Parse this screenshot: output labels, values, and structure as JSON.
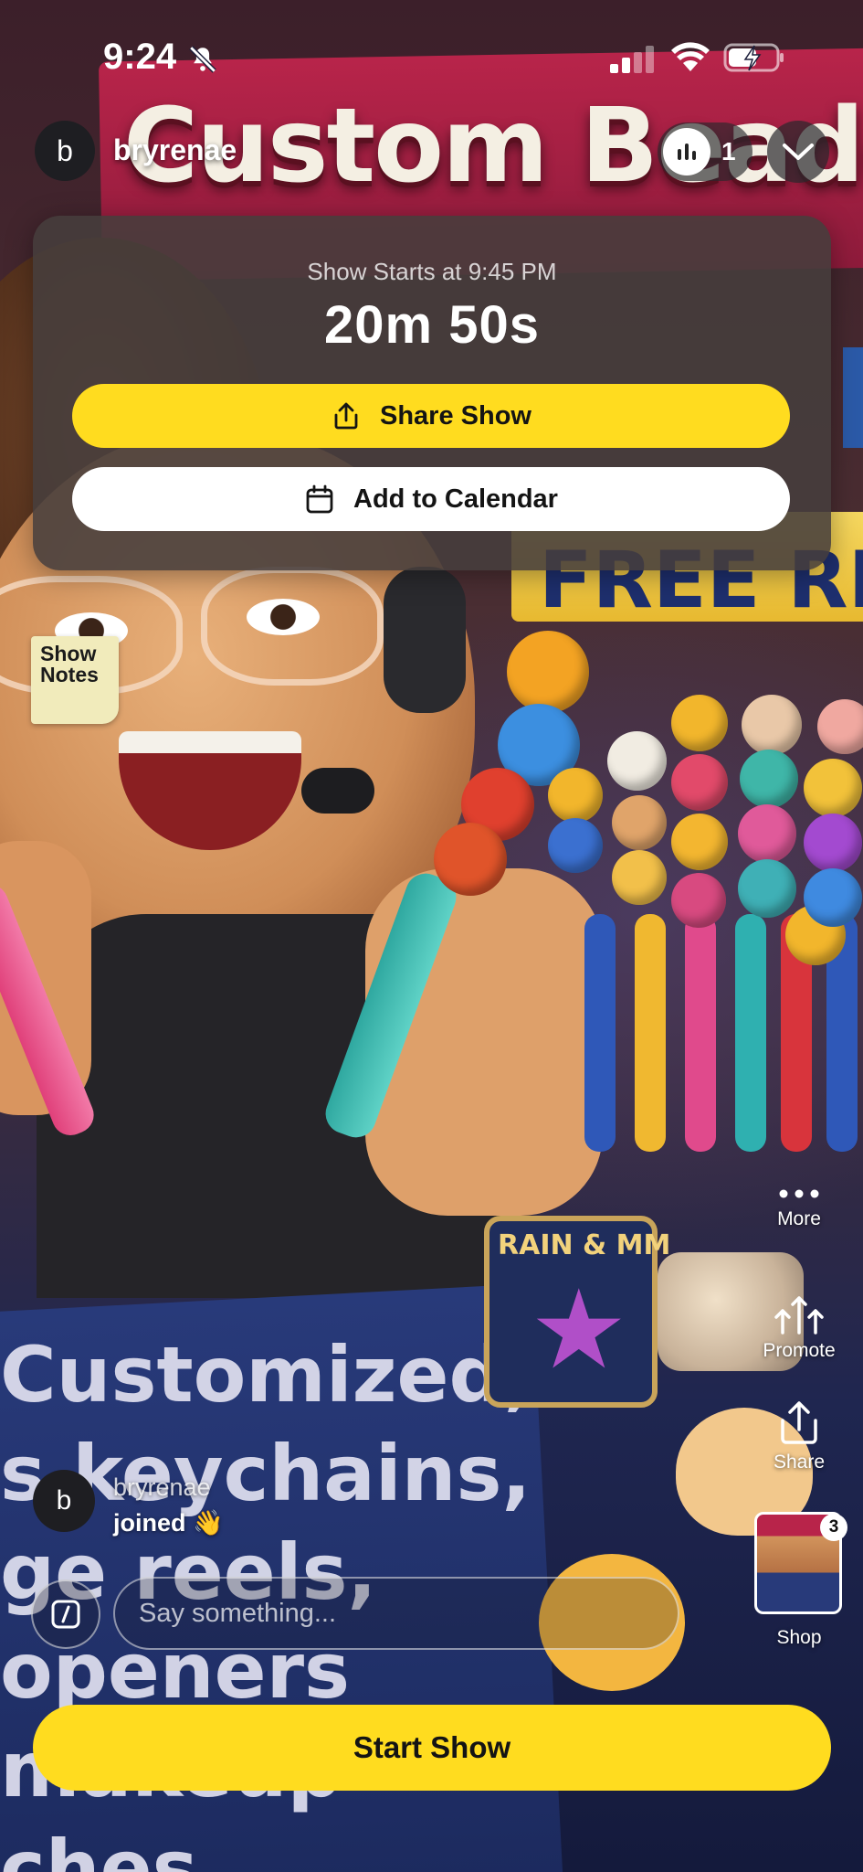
{
  "status_bar": {
    "time": "9:24",
    "icons": [
      "silent-mode-icon",
      "cellular-signal-icon",
      "wifi-icon",
      "battery-charging-icon"
    ]
  },
  "background": {
    "banner_title": "Custom Beaded P",
    "banner_strip": "FREE REFI",
    "keychain_text": "RAIN & MM",
    "bottom_banner_lines": "Customized,\ns keychains,\nge reels,\nopeners\nmakeup\nches"
  },
  "host": {
    "avatar_letter": "b",
    "name": "bryrenae"
  },
  "viewers": {
    "count": "1",
    "icon": "bar-chart-icon"
  },
  "countdown_card": {
    "starts_at": "Show Starts at 9:45 PM",
    "remaining": "20m 50s",
    "share_label": "Share Show",
    "calendar_label": "Add to Calendar"
  },
  "show_notes": {
    "line1": "Show",
    "line2": "Notes"
  },
  "rail": {
    "more_label": "More",
    "promote_label": "Promote",
    "share_label": "Share",
    "shop_label": "Shop",
    "shop_count": "3"
  },
  "chat": {
    "avatar_letter": "b",
    "username": "bryrenae",
    "message": "joined 👋"
  },
  "composer": {
    "placeholder": "Say something..."
  },
  "primary_action": {
    "label": "Start Show"
  },
  "colors": {
    "accent_yellow": "#ffdc1f",
    "card_bg": "#463e3c",
    "white": "#ffffff"
  }
}
